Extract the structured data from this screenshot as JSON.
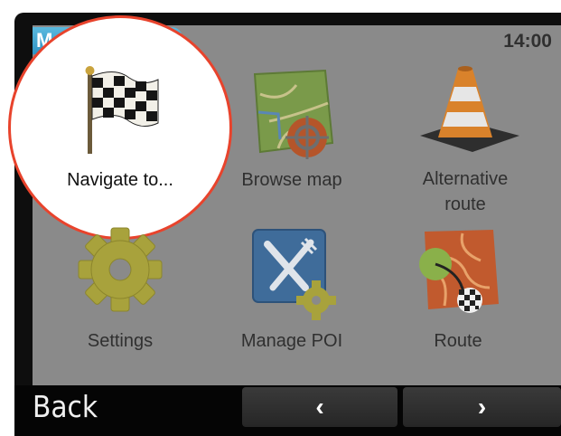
{
  "header": {
    "title": "Main menu",
    "time": "14:00"
  },
  "menu": {
    "items": [
      {
        "label": "Navigate to...",
        "icon": "checkered-flag-icon"
      },
      {
        "label": "Browse map",
        "icon": "map-icon"
      },
      {
        "label": "Alternative route",
        "icon": "traffic-cone-icon"
      },
      {
        "label": "Settings",
        "icon": "gear-icon"
      },
      {
        "label": "Manage POI",
        "icon": "fork-knife-icon"
      },
      {
        "label": "Route",
        "icon": "route-map-icon"
      }
    ]
  },
  "footer": {
    "back_label": "Back",
    "prev_glyph": "‹",
    "next_glyph": "›"
  },
  "colors": {
    "highlight_ring": "#e8432c",
    "title_bar": "#3aa6d6"
  }
}
